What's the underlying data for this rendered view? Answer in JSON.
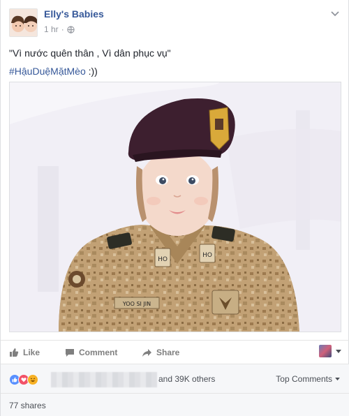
{
  "post": {
    "page_name": "Elly's Babies",
    "time": "1 hr",
    "separator": "·",
    "text_line1": "\"Vì nước quên thân , Vì dân phục vụ\"",
    "hashtag": "#HậuDuệMặtMèo",
    "hashtag_suffix": " :))"
  },
  "photo": {
    "cap_badge_text": "",
    "patch_name": "YOO SI JIN",
    "collar_left": "HO",
    "collar_right": "HO"
  },
  "actions": {
    "like": "Like",
    "comment": "Comment",
    "share": "Share"
  },
  "reactions": {
    "others_text": "and 39K others",
    "top_comments": "Top Comments"
  },
  "shares": {
    "label": "77 shares"
  },
  "colors": {
    "link_blue": "#365899",
    "action_gray": "#7f7f7f",
    "like_blue": "#5890ff",
    "love_red": "#f25268",
    "haha_yellow": "#f7b125"
  }
}
